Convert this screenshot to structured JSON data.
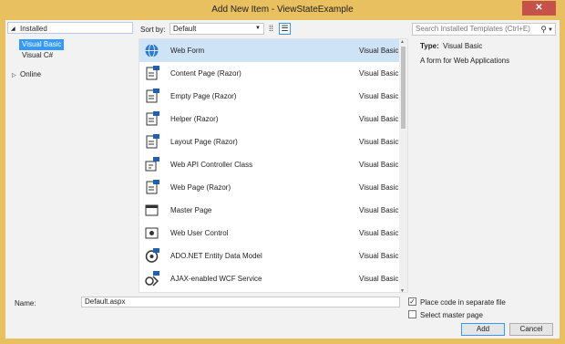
{
  "window": {
    "title": "Add New Item - ViewStateExample",
    "close_glyph": "✕"
  },
  "left": {
    "header": "Installed",
    "tree": [
      "Visual Basic",
      "Visual C#"
    ],
    "online": "Online"
  },
  "toolbar": {
    "sort_label": "Sort by:",
    "sort_value": "Default",
    "search_placeholder": "Search Installed Templates (Ctrl+E)"
  },
  "templates": [
    {
      "name": "Web Form",
      "lang": "Visual Basic",
      "icon": "globe-icon"
    },
    {
      "name": "Content Page (Razor)",
      "lang": "Visual Basic",
      "icon": "vb-page-icon"
    },
    {
      "name": "Empty Page (Razor)",
      "lang": "Visual Basic",
      "icon": "vb-page-icon"
    },
    {
      "name": "Helper (Razor)",
      "lang": "Visual Basic",
      "icon": "vb-page-icon"
    },
    {
      "name": "Layout Page (Razor)",
      "lang": "Visual Basic",
      "icon": "vb-page-icon"
    },
    {
      "name": "Web API Controller Class",
      "lang": "Visual Basic",
      "icon": "vb-class-icon"
    },
    {
      "name": "Web Page (Razor)",
      "lang": "Visual Basic",
      "icon": "vb-page-icon"
    },
    {
      "name": "Master Page",
      "lang": "Visual Basic",
      "icon": "master-page-icon"
    },
    {
      "name": "Web User Control",
      "lang": "Visual Basic",
      "icon": "user-control-icon"
    },
    {
      "name": "ADO.NET Entity Data Model",
      "lang": "Visual Basic",
      "icon": "entity-model-icon"
    },
    {
      "name": "AJAX-enabled WCF Service",
      "lang": "Visual Basic",
      "icon": "wcf-service-icon"
    }
  ],
  "details": {
    "type_label": "Type:",
    "type_value": "Visual Basic",
    "description": "A form for Web Applications"
  },
  "bottom": {
    "name_label": "Name:",
    "name_value": "Default.aspx",
    "place_code_label": "Place code in separate file",
    "place_code_checked": true,
    "master_page_label": "Select master page",
    "master_page_checked": false,
    "add_label": "Add",
    "cancel_label": "Cancel"
  },
  "colors": {
    "title_bar": "#e8c060",
    "selection": "#3399ff",
    "row_selected": "#cfe3f7",
    "close": "#c7504b"
  }
}
